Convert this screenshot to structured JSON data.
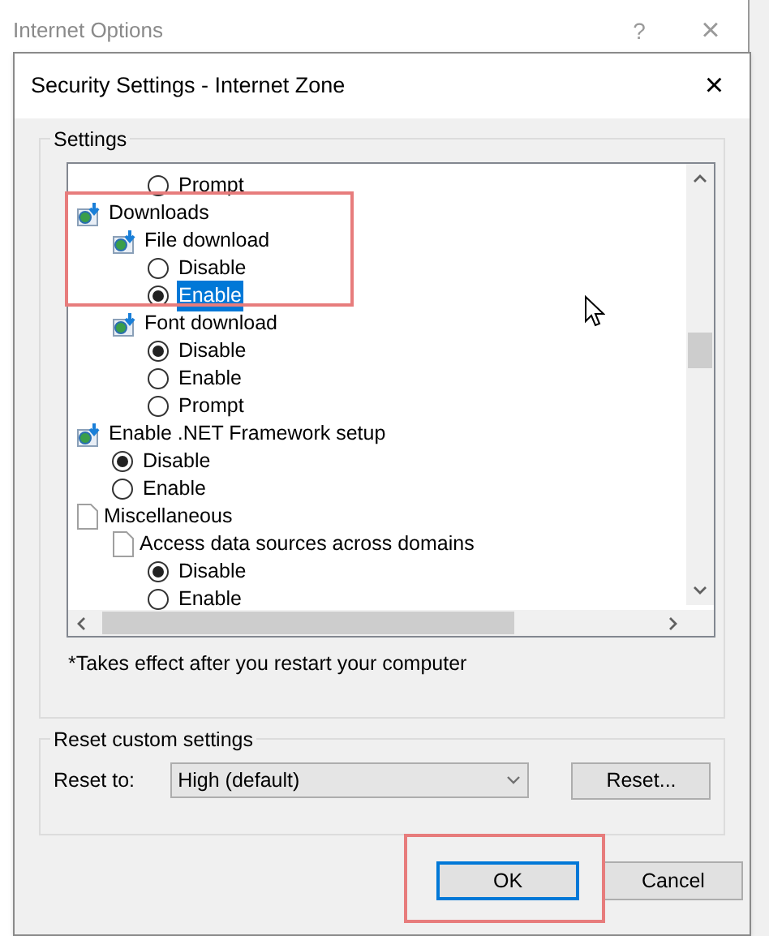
{
  "back_window": {
    "title": "Internet Options",
    "buttons": [
      "?",
      "×"
    ]
  },
  "dialog": {
    "title": "Security Settings - Internet Zone",
    "close": "×"
  },
  "settings": {
    "label": "Settings",
    "tree": [
      {
        "kind": "spacer",
        "children": [
          {
            "kind": "spacer",
            "children": [
              {
                "kind": "radio",
                "label": "Prompt",
                "checked": false,
                "selected": false
              }
            ]
          }
        ]
      },
      {
        "kind": "setting",
        "label": "Downloads",
        "children": [
          {
            "kind": "setting",
            "label": "File download",
            "children": [
              {
                "kind": "radio",
                "label": "Disable",
                "checked": false,
                "selected": false
              },
              {
                "kind": "radio",
                "label": "Enable",
                "checked": true,
                "selected": true
              }
            ]
          },
          {
            "kind": "setting",
            "label": "Font download",
            "children": [
              {
                "kind": "radio",
                "label": "Disable",
                "checked": true,
                "selected": false
              },
              {
                "kind": "radio",
                "label": "Enable",
                "checked": false,
                "selected": false
              },
              {
                "kind": "radio",
                "label": "Prompt",
                "checked": false,
                "selected": false
              }
            ]
          }
        ]
      },
      {
        "kind": "setting",
        "label": "Enable .NET Framework setup",
        "children": [
          {
            "kind": "radio",
            "label": "Disable",
            "checked": true,
            "selected": false
          },
          {
            "kind": "radio",
            "label": "Enable",
            "checked": false,
            "selected": false
          }
        ]
      },
      {
        "kind": "group",
        "label": "Miscellaneous",
        "children": [
          {
            "kind": "group",
            "label": "Access data sources across domains",
            "children": [
              {
                "kind": "radio",
                "label": "Disable",
                "checked": true,
                "selected": false
              },
              {
                "kind": "radio",
                "label": "Enable",
                "checked": false,
                "selected": false
              }
            ]
          }
        ]
      }
    ],
    "footnote": "*Takes effect after you restart your computer"
  },
  "reset": {
    "label": "Reset custom settings",
    "reset_to_label": "Reset to:",
    "reset_to_value": "High (default)",
    "button": "Reset..."
  },
  "buttons": [
    {
      "label": "OK",
      "default": true
    },
    {
      "label": "Cancel",
      "default": false
    }
  ]
}
